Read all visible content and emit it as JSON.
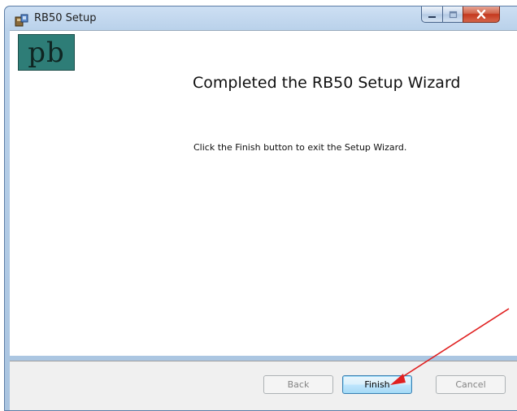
{
  "window": {
    "title": "RB50 Setup"
  },
  "logo": {
    "text": "pb"
  },
  "wizard": {
    "heading": "Completed the RB50 Setup Wizard",
    "message": "Click the Finish button to exit the Setup Wizard."
  },
  "buttons": {
    "back": "Back",
    "finish": "Finish",
    "cancel": "Cancel"
  },
  "icons": {
    "app": "installer-icon",
    "minimize": "minimize-icon",
    "maximize": "maximize-icon",
    "close": "close-icon",
    "annotation": "red-arrow-annotation"
  },
  "colors": {
    "accent": "#3c7fb1",
    "logo_bg": "#2e7d77",
    "annotation": "#e02020"
  }
}
